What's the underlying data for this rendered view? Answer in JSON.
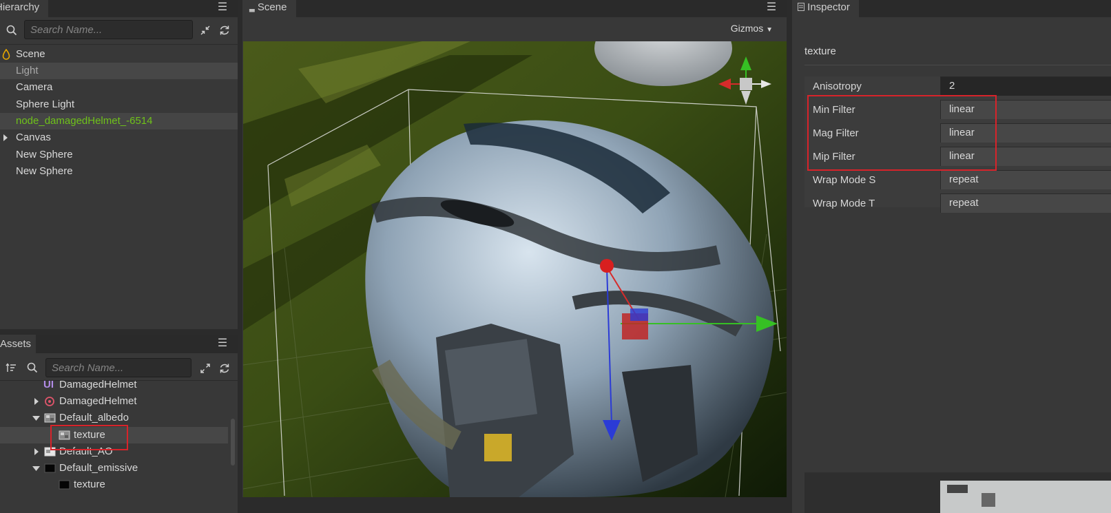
{
  "hierarchy": {
    "tab_label": "Hierarchy",
    "search_placeholder": "Search Name...",
    "nodes": [
      {
        "label": "Scene"
      },
      {
        "label": "Light"
      },
      {
        "label": "Camera"
      },
      {
        "label": "Sphere Light"
      },
      {
        "label": "node_damagedHelmet_-6514"
      },
      {
        "label": "Canvas"
      },
      {
        "label": "New Sphere"
      },
      {
        "label": "New Sphere"
      }
    ]
  },
  "assets": {
    "tab_label": "Assets",
    "search_placeholder": "Search Name...",
    "items": [
      {
        "label": "DamagedHelmet",
        "icon": "script-icon"
      },
      {
        "label": "DamagedHelmet",
        "icon": "prefab-icon"
      },
      {
        "label": "Default_albedo",
        "icon": "image-icon"
      },
      {
        "label": "texture",
        "icon": "texture-icon"
      },
      {
        "label": "Default_AO",
        "icon": "image-icon"
      },
      {
        "label": "Default_emissive",
        "icon": "image-icon"
      },
      {
        "label": "texture",
        "icon": "texture-icon"
      }
    ]
  },
  "scene": {
    "tab_label": "Scene",
    "gizmos_label": "Gizmos"
  },
  "inspector": {
    "tab_label": "Inspector",
    "section_title": "texture",
    "properties": [
      {
        "label": "Anisotropy",
        "value": "2"
      },
      {
        "label": "Min Filter",
        "value": "linear"
      },
      {
        "label": "Mag Filter",
        "value": "linear"
      },
      {
        "label": "Mip Filter",
        "value": "linear"
      },
      {
        "label": "Wrap Mode S",
        "value": "repeat"
      },
      {
        "label": "Wrap Mode T",
        "value": "repeat"
      }
    ]
  },
  "colors": {
    "highlight_box": "#d8232a",
    "node_green": "#6fc21a",
    "panel_bg": "#383838",
    "tab_bar_bg": "#2a2a2a"
  }
}
